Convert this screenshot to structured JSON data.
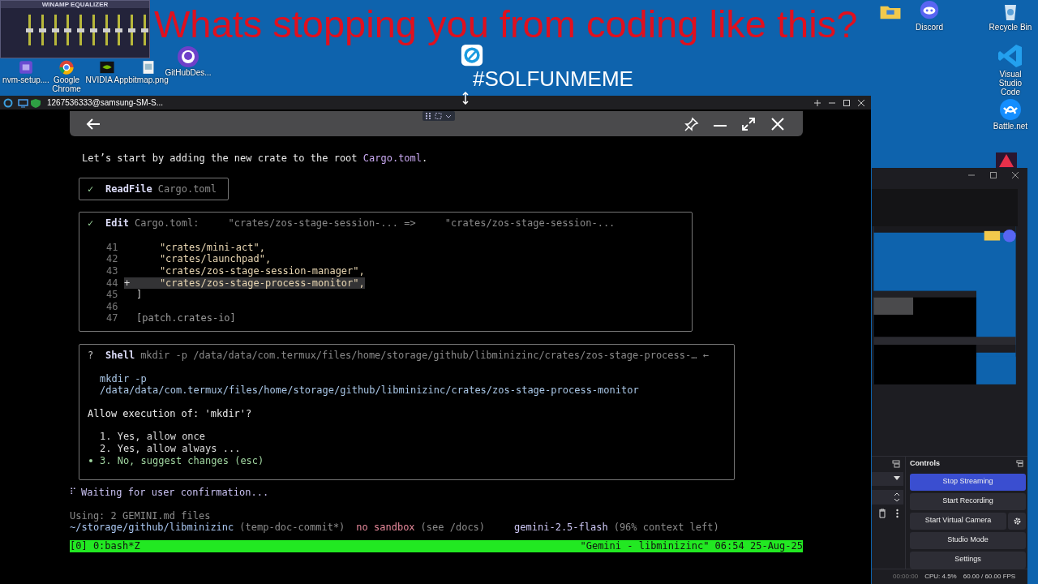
{
  "desktop": {
    "overlay_title": "Whats stopping you from coding like this?",
    "overlay_tag": "#SOLFUNMEME",
    "icons": [
      {
        "label": "nvm-setup....",
        "kind": "installer"
      },
      {
        "label": "Google Chrome",
        "kind": "chrome"
      },
      {
        "label": "NVIDIA App",
        "kind": "nvidia"
      },
      {
        "label": "bitmap.png"
      },
      {
        "label": "GitHubDes...",
        "kind": "github"
      },
      {
        "kind": "rust"
      },
      {
        "kind": "folder"
      },
      {
        "label": "Discord",
        "kind": "discord"
      },
      {
        "label": "Recycle Bin",
        "kind": "bin"
      },
      {
        "label": "Visual Studio Code",
        "kind": "vscode"
      },
      {
        "label": "Battle.net",
        "kind": "battlenet"
      }
    ],
    "equalizer": {
      "title": "WINAMP EQUALIZER",
      "bands": [
        {
          "level": 0.5
        },
        {
          "level": 0.5
        },
        {
          "level": 0.5
        },
        {
          "level": 0.5
        },
        {
          "level": 0.5
        },
        {
          "level": 0.5
        },
        {
          "level": 0.5
        },
        {
          "level": 0.5
        },
        {
          "level": 0.5
        },
        {
          "level": 0.5
        }
      ]
    }
  },
  "terminal_window": {
    "title": "1267536333@samsung-SM-S...",
    "intro": [
      {
        "text": "Let’s start by adding the new crate to the root ",
        "kind": "plain"
      },
      {
        "text": "Cargo.toml",
        "kind": "file"
      },
      {
        "text": ".",
        "kind": "plain"
      }
    ],
    "tools": [
      {
        "status": "✓",
        "name": "ReadFile",
        "detail": "Cargo.toml",
        "kind": "read"
      },
      {
        "status": "✓",
        "name": "Edit",
        "detail": "Cargo.toml:     \"crates/zos-stage-session-... =>     \"crates/zos-stage-session-...",
        "kind": "edit",
        "diff": [
          {
            "number": "41",
            "code": "    \"crates/mini-act\",",
            "kind": "string",
            "added": false
          },
          {
            "number": "42",
            "code": "    \"crates/launchpad\",",
            "kind": "string",
            "added": false
          },
          {
            "number": "43",
            "code": "    \"crates/zos-stage-session-manager\",",
            "kind": "string",
            "added": false
          },
          {
            "number": "44",
            "sign": "+",
            "code": "    \"crates/zos-stage-process-monitor\",",
            "kind": "string",
            "added": true
          },
          {
            "number": "45",
            "code": "]",
            "kind": "plain",
            "added": false
          },
          {
            "number": "46",
            "kind": "blank",
            "added": false
          },
          {
            "number": "47",
            "code": "[patch.crates-io]",
            "kind": "section",
            "added": false
          }
        ]
      },
      {
        "status": "?",
        "name": "Shell",
        "detail": "mkdir -p /data/data/com.termux/files/home/storage/github/libminizinc/crates/zos-stage-process-… ←",
        "kind": "shell",
        "command": [
          "mkdir -p",
          "/data/data/com.termux/files/home/storage/github/libminizinc/crates/zos-stage-process-monitor"
        ],
        "question": "Allow execution of: 'mkdir'?",
        "options": [
          {
            "label": "1. Yes, allow once",
            "selected": false
          },
          {
            "label": "2. Yes, allow always ...",
            "selected": false
          },
          {
            "label": "3. No, suggest changes (esc)",
            "selected": true
          }
        ]
      }
    ],
    "waiting": {
      "spinner": "⠏",
      "text": "Waiting for user confirmation..."
    },
    "footer": {
      "using": "Using: 2 GEMINI.md files",
      "path": "~/storage/github/libminizinc",
      "branch": "(temp-doc-commit*)",
      "sandbox": "no sandbox",
      "sandbox_note": "(see /docs)",
      "model": "gemini-2.5-flash",
      "context": "(96% context left)"
    },
    "tmux": {
      "left": "[0] 0:bash*Z",
      "right": "\"Gemini - libminizinc\" 06:54 25-Aug-25"
    }
  },
  "obs": {
    "controls_title": "Controls",
    "buttons": [
      {
        "label": "Stop Streaming",
        "active": true
      },
      {
        "label": "Start Recording",
        "active": false
      },
      {
        "label": "Start Virtual Camera",
        "active": false
      },
      {
        "label": "Studio Mode",
        "active": false
      },
      {
        "label": "Settings",
        "active": false
      }
    ],
    "status": {
      "time": "00:00:00",
      "cpu": "CPU: 4.5%",
      "fps": "60.00 / 60.00 FPS"
    }
  }
}
